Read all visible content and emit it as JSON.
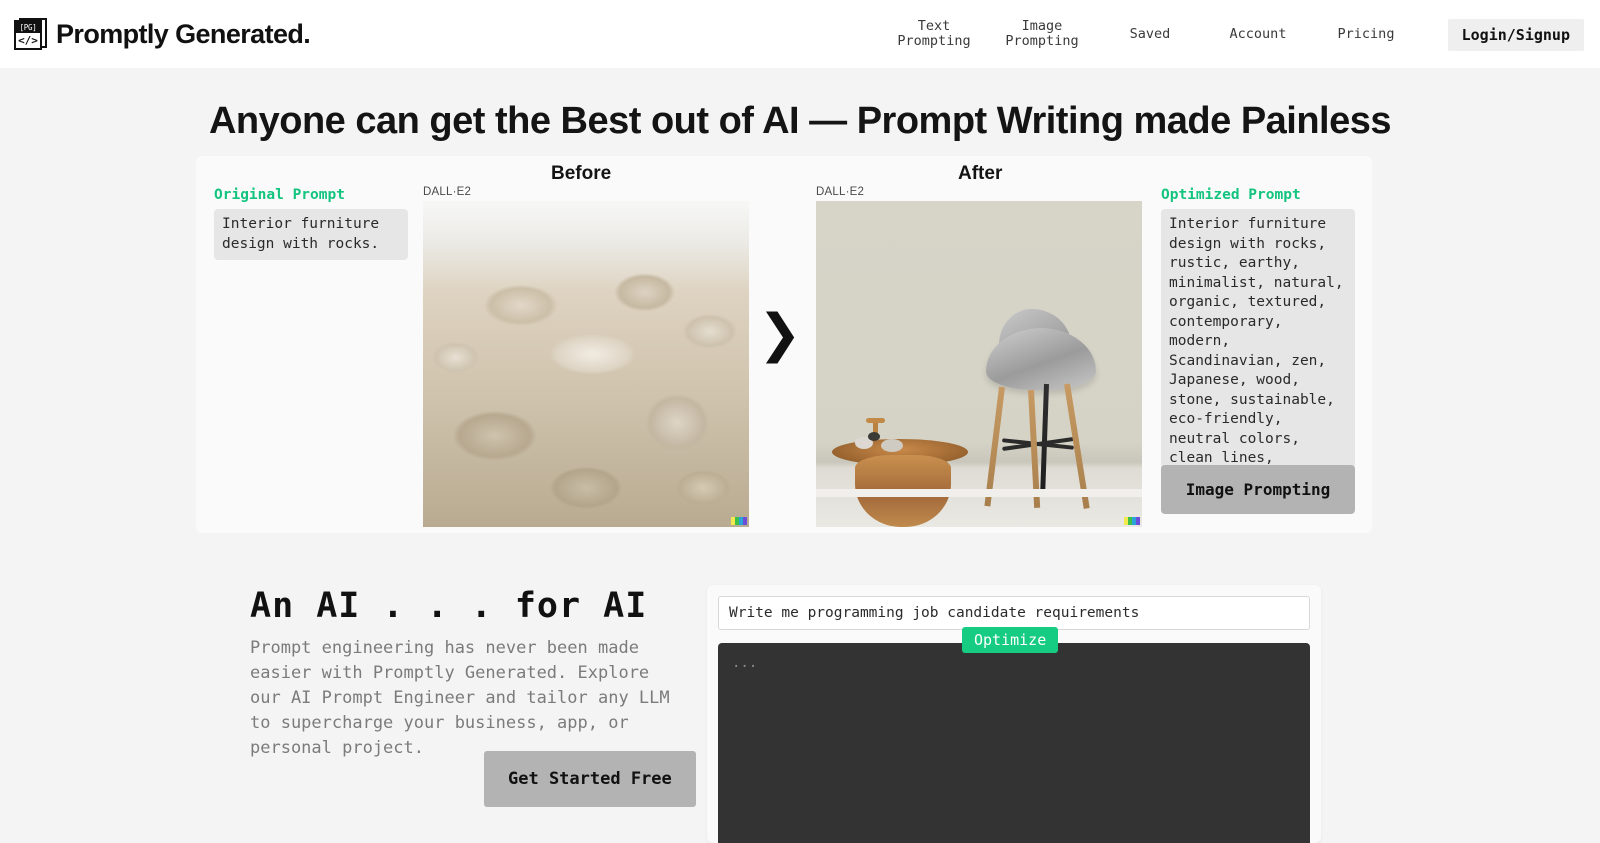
{
  "header": {
    "logo": {
      "top_text": "[PG]",
      "bottom_text": "</>"
    },
    "brand_name": "Promptly Generated.",
    "nav": [
      {
        "label": "Text\nPrompting"
      },
      {
        "label": "Image\nPrompting"
      },
      {
        "label": "Saved"
      },
      {
        "label": "Account"
      },
      {
        "label": "Pricing"
      }
    ],
    "login_label": "Login/Signup"
  },
  "hero": {
    "headline": "Anyone can get the Best out of AI —  Prompt Writing made Painless"
  },
  "compare": {
    "before_label": "Before",
    "after_label": "After",
    "arrow_glyph": "❯",
    "original_prompt_label": "Original Prompt",
    "original_prompt_text": "Interior furniture design with rocks.",
    "optimized_prompt_label": "Optimized Prompt",
    "optimized_prompt_text": "Interior furniture design with rocks, rustic, earthy, minimalist, natural, organic, textured, contemporary, modern, Scandinavian, zen, Japanese, wood, stone, sustainable, eco-friendly, neutral colors, clean lines, spatial, cozy.",
    "before_model_tag": "DALL·E2",
    "after_model_tag": "DALL·E2",
    "image_prompting_button": "Image Prompting"
  },
  "lower": {
    "title": "An AI . . . for AI",
    "body": "Prompt engineering has never been made easier with Promptly Generated. Explore our AI Prompt Engineer and tailor any LLM to supercharge your business, app, or personal project.",
    "cta_label": "Get Started Free"
  },
  "demo": {
    "input_value": "Write me programming job candidate requirements",
    "input_placeholder": "Write me programming job candidate requirements",
    "optimize_label": "Optimize",
    "output_text": "..."
  },
  "colors": {
    "accent_green": "#16cc82",
    "prompt_label_green": "#12c47e",
    "button_gray": "#b3b3b3",
    "output_dark": "#333333",
    "page_bg": "#f4f4f4"
  }
}
